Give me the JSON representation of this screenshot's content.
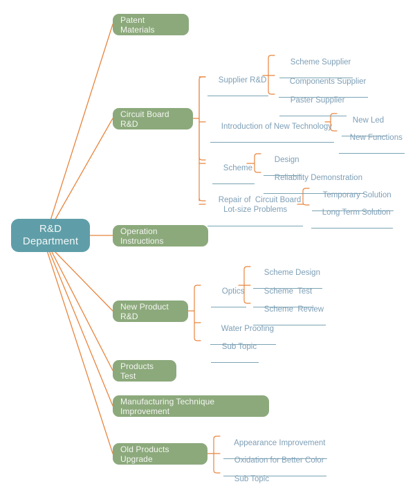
{
  "meta": {
    "kind": "mind-map",
    "colors": {
      "root_fill": "#5f9ea8",
      "branch_fill": "#8ca97c",
      "connector": "#e8843c",
      "topic_text": "#7e9fb6",
      "topic_underline": "#79a3b3",
      "background": "#ffffff"
    }
  },
  "root": {
    "label": "R&D\nDepartment"
  },
  "branches": [
    {
      "id": "patent",
      "label": "Patent Materials"
    },
    {
      "id": "circuit",
      "label": "Circuit Board R&D"
    },
    {
      "id": "operation",
      "label": "Operation Instructions"
    },
    {
      "id": "newproduct",
      "label": "New Product R&D"
    },
    {
      "id": "productstest",
      "label": "Products Test"
    },
    {
      "id": "manufacturing",
      "label": "Manufacturing Technique Improvement"
    },
    {
      "id": "oldproducts",
      "label": "Old Products Upgrade"
    }
  ],
  "circuit_children": [
    {
      "id": "supplier",
      "label": "Supplier R&D"
    },
    {
      "id": "intronew",
      "label": "Introduction of New Technology"
    },
    {
      "id": "scheme",
      "label": "Scheme"
    },
    {
      "id": "repair",
      "label": "Repair of  Circuit Board\nLot-size Problems"
    }
  ],
  "supplier_children": [
    {
      "id": "schemesup",
      "label": "Scheme Supplier"
    },
    {
      "id": "compsup",
      "label": "Components Supplier"
    },
    {
      "id": "pastersup",
      "label": "Paster Supplier"
    }
  ],
  "intronew_children": [
    {
      "id": "newled",
      "label": "New Led"
    },
    {
      "id": "newfunc",
      "label": "New Functions"
    }
  ],
  "scheme_children": [
    {
      "id": "design",
      "label": "Design"
    },
    {
      "id": "reliability",
      "label": "Reliability Demonstration"
    }
  ],
  "repair_children": [
    {
      "id": "temporary",
      "label": "Temporary Solution"
    },
    {
      "id": "longterm",
      "label": "Long Term Solution"
    }
  ],
  "newproduct_children": [
    {
      "id": "optics",
      "label": "Optics"
    },
    {
      "id": "waterproof",
      "label": "Water Proofing"
    },
    {
      "id": "subtopic1",
      "label": "Sub Topic"
    }
  ],
  "optics_children": [
    {
      "id": "schemedesign",
      "label": "Scheme Design"
    },
    {
      "id": "schemetest",
      "label": "Scheme  Test"
    },
    {
      "id": "schemereview",
      "label": "Scheme  Review"
    }
  ],
  "oldproducts_children": [
    {
      "id": "appearance",
      "label": "Appearance Improvement"
    },
    {
      "id": "oxidation",
      "label": "Oxidation for Better Color"
    },
    {
      "id": "subtopic2",
      "label": "Sub Topic"
    }
  ]
}
